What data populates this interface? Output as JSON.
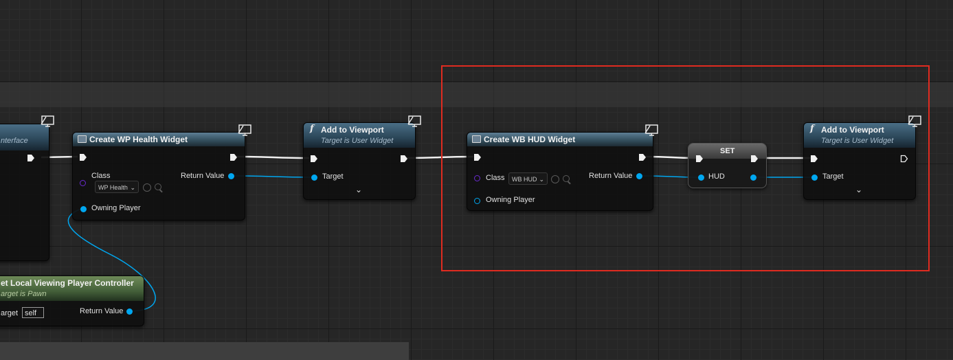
{
  "nodes": {
    "interface_node": {
      "subtitle": "nterface"
    },
    "create_wp_health": {
      "title": "Create WP Health Widget",
      "class_label": "Class",
      "class_value": "WP Health",
      "return_label": "Return Value",
      "owning_player_label": "Owning Player"
    },
    "add_viewport_1": {
      "title": "Add to Viewport",
      "subtitle": "Target is User Widget",
      "target_label": "Target"
    },
    "create_wb_hud": {
      "title": "Create WB HUD Widget",
      "class_label": "Class",
      "class_value": "WB HUD",
      "return_label": "Return Value",
      "owning_player_label": "Owning Player"
    },
    "set_node": {
      "title": "SET",
      "hud_label": "HUD"
    },
    "add_viewport_2": {
      "title": "Add to Viewport",
      "subtitle": "Target is User Widget",
      "target_label": "Target"
    },
    "get_local_controller": {
      "title": "et Local Viewing Player Controller",
      "subtitle": "arget is Pawn",
      "target_label": "arget",
      "self_value": "self",
      "return_label": "Return Value"
    }
  },
  "icons": {
    "function": "f",
    "chevron": "⌄"
  },
  "colors": {
    "object_pin": "#00a7f0",
    "class_pin": "#6a2bd0",
    "exec_wire": "#f0f0f0",
    "highlight": "#e02b20"
  }
}
